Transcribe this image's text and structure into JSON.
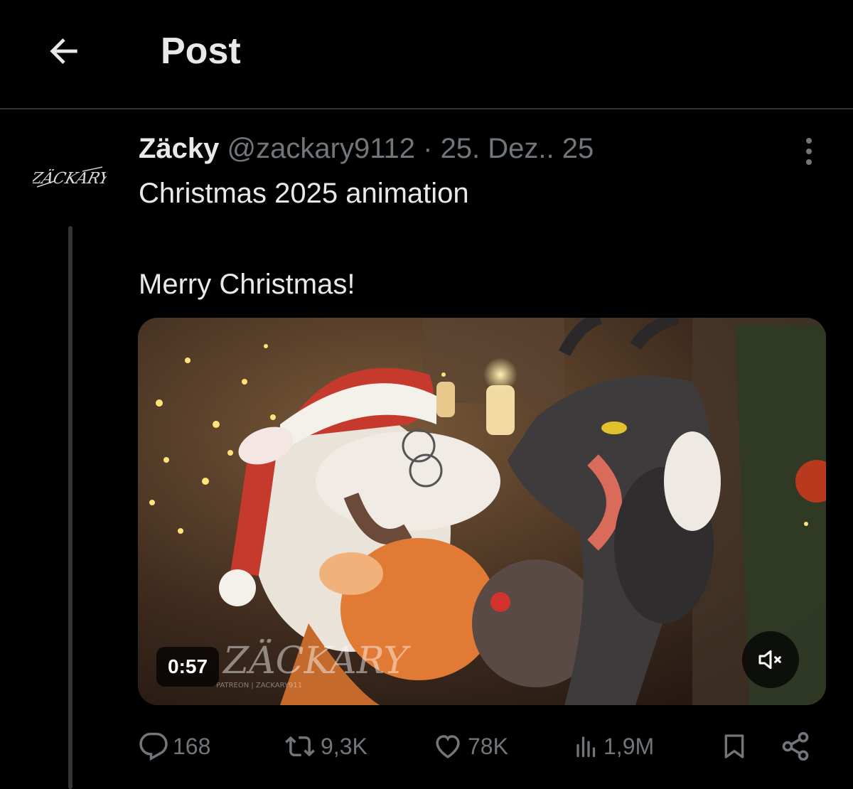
{
  "header": {
    "title": "Post",
    "back_icon": "arrow-left-icon"
  },
  "tweet": {
    "author": {
      "display_name": "Zäcky",
      "handle": "@zackary9112",
      "avatar_text": "ZÄCKARY"
    },
    "separator": "·",
    "date": "25. Dez.. 25",
    "text_lines": [
      "Christmas 2025 animation",
      "Merry Christmas!"
    ],
    "media": {
      "type": "video",
      "duration": "0:57",
      "muted": true,
      "watermark": "ZÄCKARY",
      "watermark_sub": "PATREON | ZACKARY911"
    },
    "stats": {
      "replies": "168",
      "reposts": "9,3K",
      "likes": "78K",
      "views": "1,9M"
    }
  },
  "icons": {
    "more": "more-vertical-icon",
    "reply": "reply-icon",
    "repost": "repost-icon",
    "like": "heart-icon",
    "views": "views-icon",
    "bookmark": "bookmark-icon",
    "share": "share-icon",
    "mute": "volume-muted-icon"
  },
  "colors": {
    "background": "#000000",
    "primary_text": "#e7e9ea",
    "secondary_text": "#71767b",
    "border": "#2f3336"
  }
}
